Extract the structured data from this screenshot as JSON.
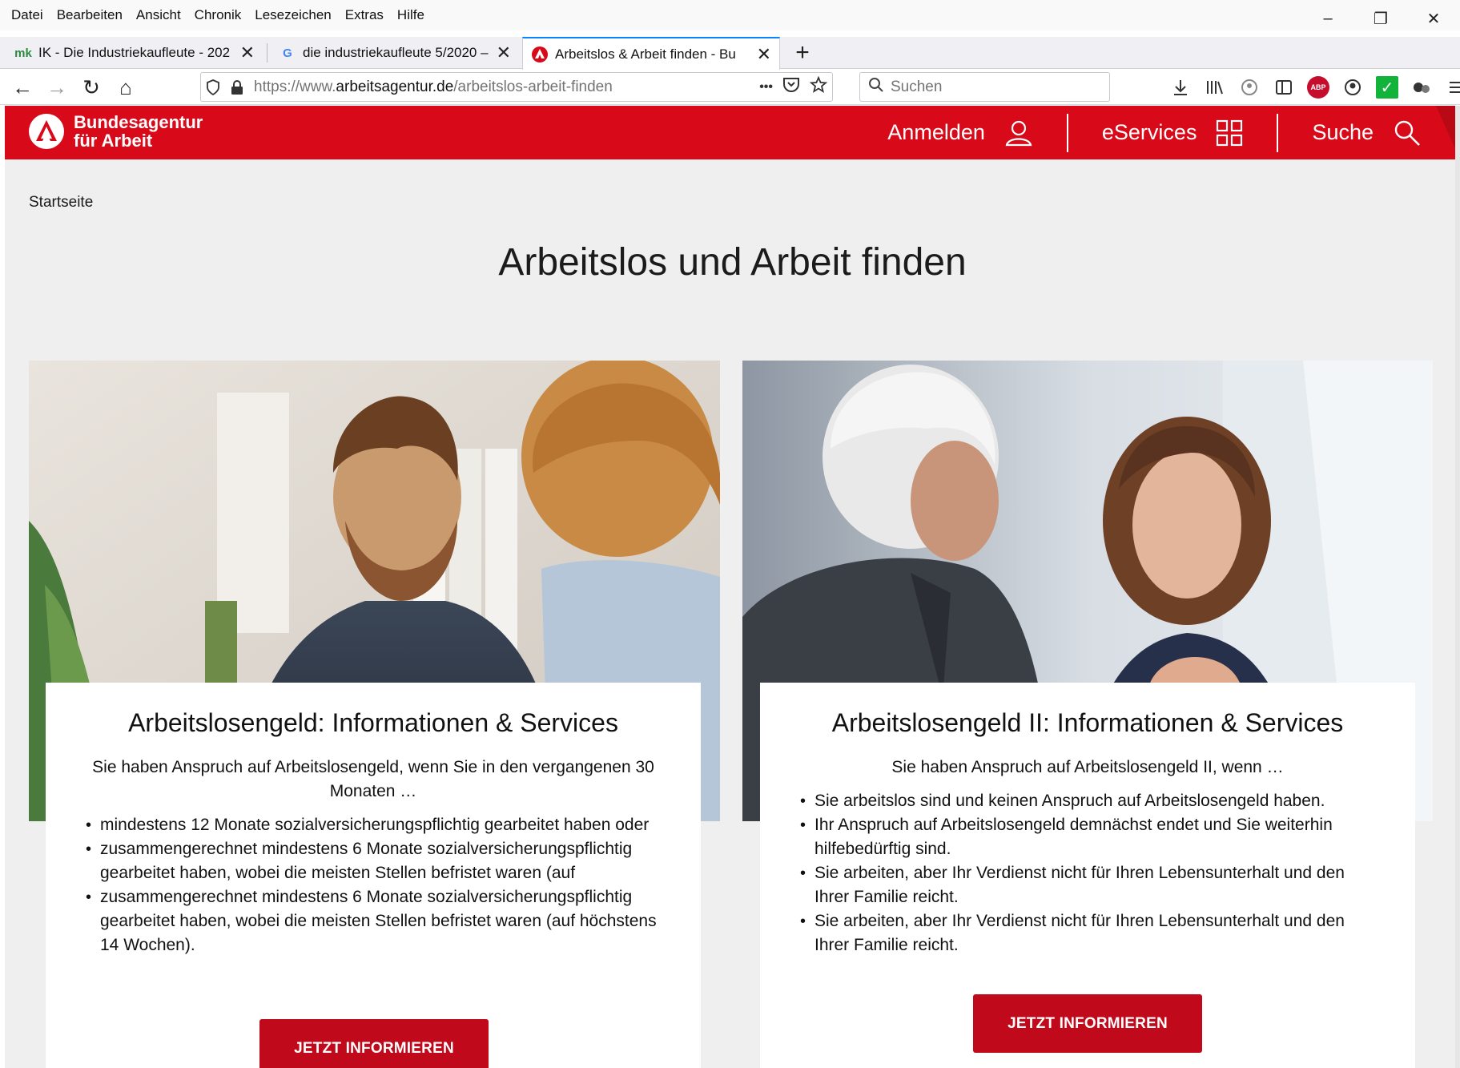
{
  "menubar": {
    "items": [
      {
        "label": "Datei"
      },
      {
        "label": "Bearbeiten"
      },
      {
        "label": "Ansicht"
      },
      {
        "label": "Chronik"
      },
      {
        "label": "Lesezeichen"
      },
      {
        "label": "Extras"
      },
      {
        "label": "Hilfe"
      }
    ]
  },
  "window_controls": {
    "minimize": "–",
    "restore": "❐",
    "close": "✕"
  },
  "tabs": [
    {
      "favicon": "mk",
      "title": "IK - Die Industriekaufleute - 202",
      "close": "✕"
    },
    {
      "favicon": "G",
      "title": "die industriekaufleute 5/2020 –",
      "close": "✕"
    },
    {
      "favicon": "ba-logo-icon",
      "title": "Arbeitslos & Arbeit finden - Bu",
      "close": "✕"
    }
  ],
  "newtab": "+",
  "navigation": {
    "back": "←",
    "forward": "→",
    "reload": "↻",
    "home": "⌂",
    "url_prefix": "https://www.",
    "url_domain": "arbeitsagentur.de",
    "url_path": "/arbeitslos-arbeit-finden",
    "more": "•••",
    "search_placeholder": "Suchen"
  },
  "site": {
    "logo_line1": "Bundesagentur",
    "logo_line2": "für Arbeit",
    "nav": {
      "login": "Anmelden",
      "eservices": "eServices",
      "search": "Suche"
    },
    "brand_color": "#d80a1a"
  },
  "breadcrumb": "Startseite",
  "page_title": "Arbeitslos und Arbeit finden",
  "cards": [
    {
      "title": "Arbeitslosengeld: Informationen & Services",
      "intro": "Sie haben Anspruch auf Arbeitslosengeld, wenn Sie in den vergangenen 30 Monaten …",
      "bullets": [
        "mindestens 12 Monate sozialversicherungspflichtig gearbeitet haben oder",
        "zusammengerechnet mindestens 6 Monate sozialversicherungspflichtig gearbeitet haben, wobei die meisten Stellen befristet waren (auf",
        "zusammengerechnet mindestens 6 Monate sozialversicherungspflichtig gearbeitet haben, wobei die meisten Stellen befristet waren (auf höchstens 14 Wochen)."
      ],
      "cta": "JETZT INFORMIEREN"
    },
    {
      "title": "Arbeitslosengeld II: Informationen & Services",
      "intro": "Sie haben Anspruch auf Arbeitslosengeld II, wenn …",
      "bullets": [
        "Sie arbeitslos sind und keinen Anspruch auf Arbeitslosengeld haben.",
        "Ihr Anspruch auf Arbeitslosengeld demnächst endet und Sie weiterhin hilfebedürftig sind.",
        "Sie arbeiten, aber Ihr Verdienst nicht für Ihren Lebensunterhalt und den Ihrer Familie reicht.",
        "Sie arbeiten, aber Ihr Verdienst nicht für Ihren Lebensunterhalt und den Ihrer Familie reicht."
      ],
      "cta": "JETZT INFORMIEREN"
    }
  ]
}
